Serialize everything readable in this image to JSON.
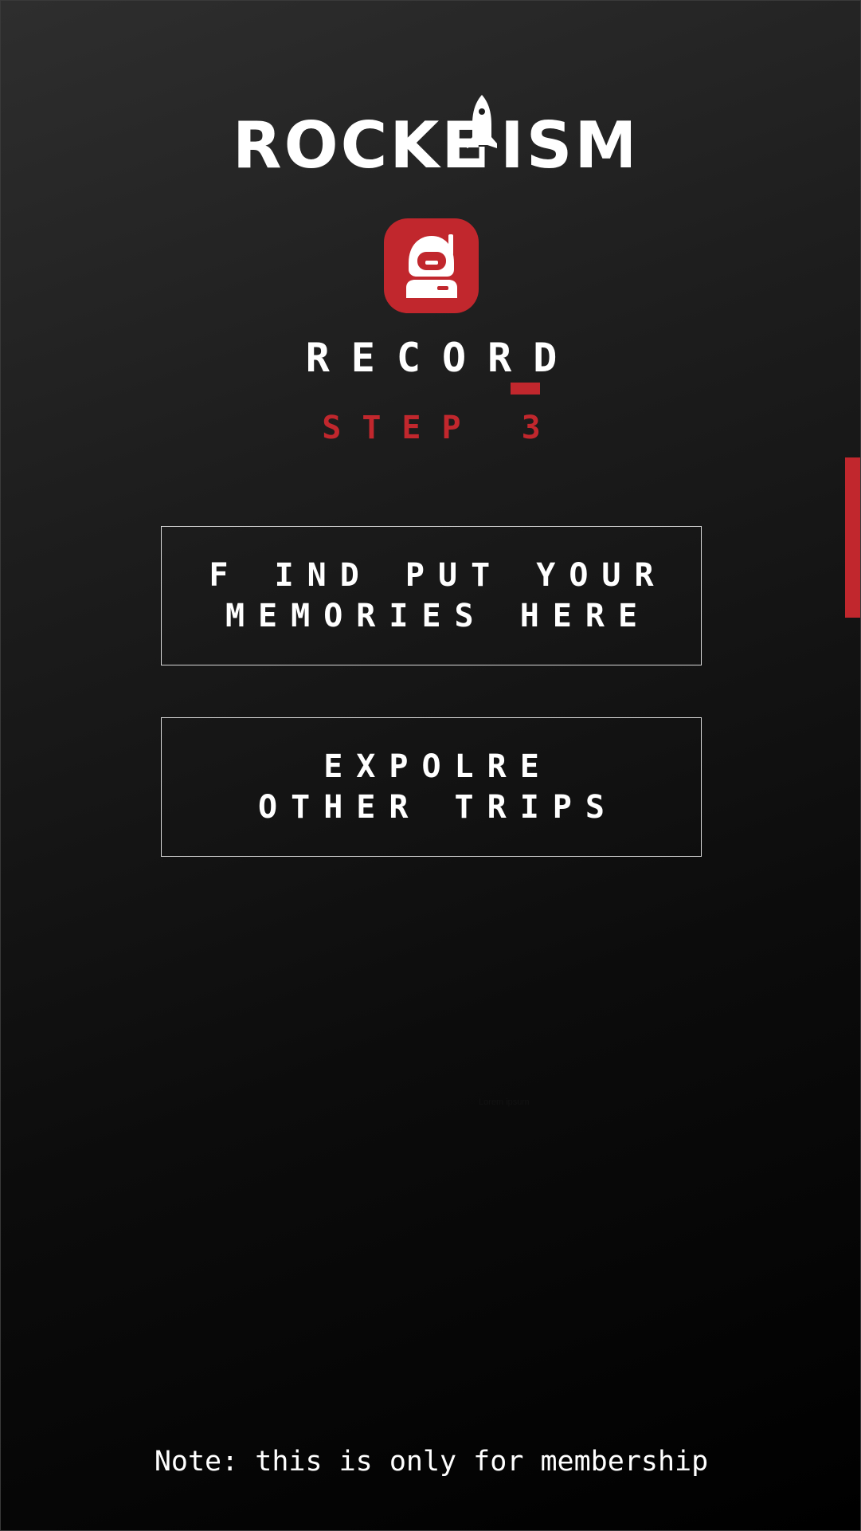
{
  "logo": {
    "text_left": "ROCKE",
    "text_right": "ISM",
    "icon": "rocket-icon"
  },
  "record_icon": "astronaut-icon",
  "title": "RECORD",
  "step": "STEP 3",
  "buttons": {
    "memories": {
      "line1": "F IND PUT YOUR",
      "line2": "MEMORIES HERE"
    },
    "explore": {
      "line1": "EXPOLRE",
      "line2": "OTHER TRIPS"
    }
  },
  "placeholder_text": "Lorem ipsum",
  "note": "Note: this is only for membership",
  "colors": {
    "accent": "#c1272d",
    "background_top": "#2e2e2e",
    "background_bottom": "#000000",
    "text": "#ffffff"
  }
}
